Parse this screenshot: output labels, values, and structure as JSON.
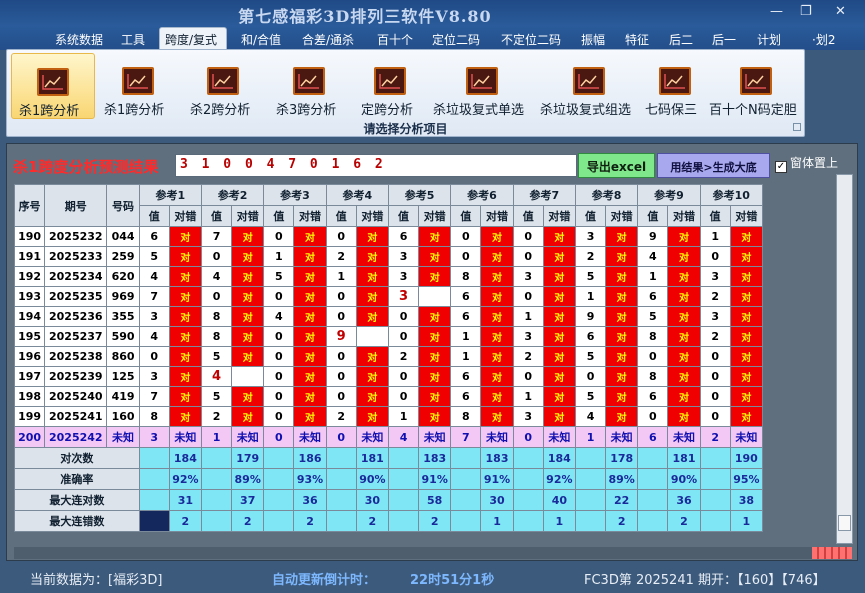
{
  "window": {
    "title": "第七感福彩3D排列三软件V8.80",
    "min_glyph": "—",
    "max_glyph": "❐",
    "close_glyph": "✕"
  },
  "menu": [
    "系统数据",
    "工具",
    "跨度/复式",
    "和/合值",
    "合差/通杀",
    "百十个",
    "定位二码",
    "不定位二码",
    "振幅",
    "特征",
    "后二",
    "后一",
    "计划",
    "·划2"
  ],
  "menu_active": "跨度/复式",
  "ribbon": {
    "buttons": [
      "杀1跨分析",
      "杀1跨分析",
      "杀2跨分析",
      "杀3跨分析",
      "定跨分析",
      "杀垃圾复式单选",
      "杀垃圾复式组选",
      "七码保三",
      "百十个N码定胆"
    ],
    "selected_index": 0,
    "caption": "请选择分析项目",
    "icon": "chart-icon"
  },
  "result": {
    "title": "杀1跨度分析预测结果",
    "value": "3 1 0 0 4 7 0 1 6 2",
    "export_label": "导出excel",
    "generate_label": "用结果>生成大底",
    "topmost_label": "窗体置上",
    "topmost_checked": "✓"
  },
  "table": {
    "col_headers": [
      "序号",
      "期号",
      "号码"
    ],
    "refs": [
      "参考1",
      "参考2",
      "参考3",
      "参考4",
      "参考5",
      "参考6",
      "参考7",
      "参考8",
      "参考9",
      "参考10"
    ],
    "sub_value": "值",
    "sub_check": "对错",
    "ok_text": "对",
    "rows": [
      {
        "seq": "190",
        "period": "2025232",
        "code": "044",
        "vals": [
          "6",
          "7",
          "0",
          "0",
          "6",
          "0",
          "0",
          "3",
          "9",
          "1"
        ],
        "bad": []
      },
      {
        "seq": "191",
        "period": "2025233",
        "code": "259",
        "vals": [
          "5",
          "0",
          "1",
          "2",
          "3",
          "0",
          "0",
          "2",
          "4",
          "0"
        ],
        "bad": []
      },
      {
        "seq": "192",
        "period": "2025234",
        "code": "620",
        "vals": [
          "4",
          "4",
          "5",
          "1",
          "3",
          "8",
          "3",
          "5",
          "1",
          "3"
        ],
        "bad": []
      },
      {
        "seq": "193",
        "period": "2025235",
        "code": "969",
        "vals": [
          "7",
          "0",
          "0",
          "0",
          "3",
          "6",
          "0",
          "1",
          "6",
          "2"
        ],
        "bad": [
          4
        ]
      },
      {
        "seq": "194",
        "period": "2025236",
        "code": "355",
        "vals": [
          "3",
          "8",
          "4",
          "0",
          "0",
          "6",
          "1",
          "9",
          "5",
          "3"
        ],
        "bad": []
      },
      {
        "seq": "195",
        "period": "2025237",
        "code": "590",
        "vals": [
          "4",
          "8",
          "0",
          "9",
          "0",
          "1",
          "3",
          "6",
          "8",
          "2"
        ],
        "bad": [
          3
        ]
      },
      {
        "seq": "196",
        "period": "2025238",
        "code": "860",
        "vals": [
          "0",
          "5",
          "0",
          "0",
          "2",
          "1",
          "2",
          "5",
          "0",
          "0"
        ],
        "bad": []
      },
      {
        "seq": "197",
        "period": "2025239",
        "code": "125",
        "vals": [
          "3",
          "4",
          "0",
          "0",
          "0",
          "6",
          "0",
          "0",
          "8",
          "0"
        ],
        "bad": [
          1
        ]
      },
      {
        "seq": "198",
        "period": "2025240",
        "code": "419",
        "vals": [
          "7",
          "5",
          "0",
          "0",
          "0",
          "6",
          "1",
          "5",
          "6",
          "0"
        ],
        "bad": []
      },
      {
        "seq": "199",
        "period": "2025241",
        "code": "160",
        "vals": [
          "8",
          "2",
          "0",
          "2",
          "1",
          "8",
          "3",
          "4",
          "0",
          "0"
        ],
        "bad": []
      }
    ],
    "unknown_row": {
      "seq": "200",
      "period": "2025242",
      "code": "未知",
      "vals": [
        "3",
        "1",
        "0",
        "0",
        "4",
        "7",
        "0",
        "1",
        "6",
        "2"
      ],
      "unknown_text": "未知"
    },
    "stats": [
      {
        "label": "对次数",
        "values": [
          "184",
          "179",
          "186",
          "181",
          "183",
          "183",
          "184",
          "178",
          "181",
          "190"
        ]
      },
      {
        "label": "准确率",
        "values": [
          "92%",
          "89%",
          "93%",
          "90%",
          "91%",
          "91%",
          "92%",
          "89%",
          "90%",
          "95%"
        ]
      },
      {
        "label": "最大连对数",
        "values": [
          "31",
          "37",
          "36",
          "30",
          "58",
          "30",
          "40",
          "22",
          "36",
          "38"
        ]
      },
      {
        "label": "最大连错数",
        "values": [
          "2",
          "2",
          "2",
          "2",
          "2",
          "1",
          "1",
          "2",
          "2",
          "1"
        ]
      }
    ]
  },
  "status": {
    "current_data": "当前数据为：[福彩3D]",
    "countdown_label": "自动更新倒计时：",
    "countdown_value": "22时51分1秒",
    "period_info": "FC3D第 2025241 期开：【160】【746】"
  },
  "colors": {
    "ok_bg": "#f00000",
    "ok_text": "#ffff00",
    "stat_bg": "#7ee6f4",
    "unknown_bg": "#f4c8f4",
    "export_bg": "#7fe88a",
    "generate_bg": "#a8a8ee"
  }
}
